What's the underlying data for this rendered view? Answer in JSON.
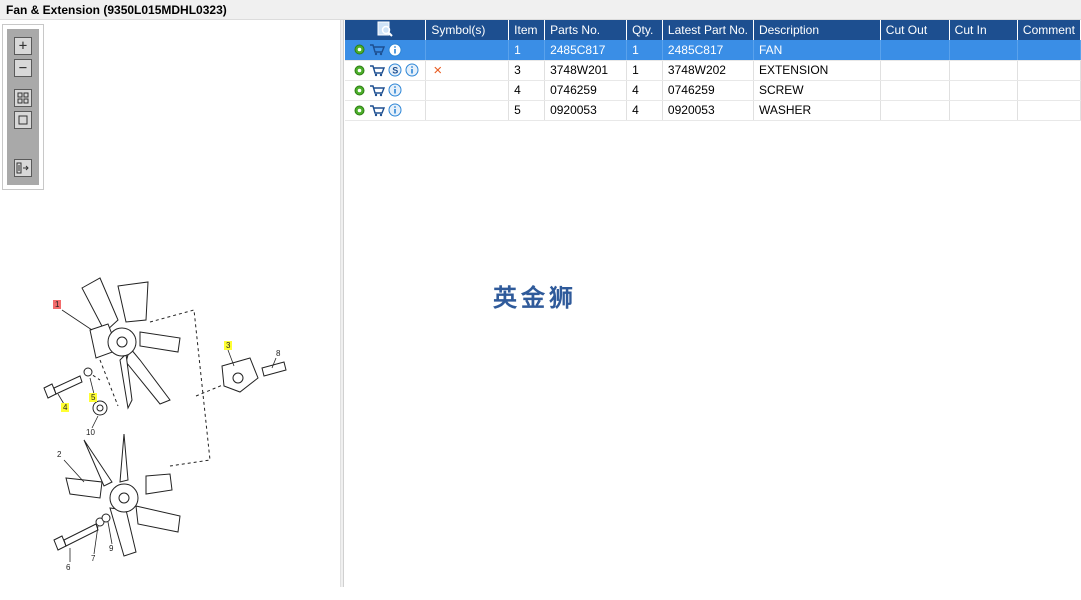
{
  "window": {
    "title": "Fan & Extension (9350L015MDHL0323)"
  },
  "toolbox": {
    "buttons": [
      {
        "name": "zoom-in-icon",
        "glyph": "+"
      },
      {
        "name": "zoom-out-icon",
        "glyph": "−"
      },
      {
        "name": "fit-grid-icon",
        "glyph": "▦"
      },
      {
        "name": "actual-size-icon",
        "glyph": "□"
      },
      {
        "name": "export-list-icon",
        "glyph": "☰"
      }
    ]
  },
  "drawing": {
    "callouts": [
      {
        "label": "1",
        "highlight": "#f26b6b"
      },
      {
        "label": "3",
        "highlight": "#ffff33"
      },
      {
        "label": "4",
        "highlight": "#ffff33"
      },
      {
        "label": "5",
        "highlight": "#ffff33"
      },
      {
        "label": "8",
        "highlight": ""
      },
      {
        "label": "10",
        "highlight": ""
      },
      {
        "label": "2",
        "highlight": ""
      },
      {
        "label": "6",
        "highlight": ""
      },
      {
        "label": "7",
        "highlight": ""
      },
      {
        "label": "9",
        "highlight": ""
      }
    ]
  },
  "table": {
    "header_icon": "search-doc-icon",
    "columns": [
      "",
      "Symbol(s)",
      "Item",
      "Parts No.",
      "Qty.",
      "Latest Part No.",
      "Description",
      "Cut Out",
      "Cut In",
      "Comment"
    ],
    "rows": [
      {
        "icons": [
          "gear-icon",
          "cart-icon",
          "info-icon"
        ],
        "symbol": "",
        "item": "1",
        "part_no": "2485C817",
        "qty": "1",
        "latest": "2485C817",
        "desc": "FAN",
        "cut_out": "",
        "cut_in": "",
        "comment": ""
      },
      {
        "icons": [
          "gear-icon",
          "cart-icon",
          "s-icon",
          "info-icon"
        ],
        "symbol": "×",
        "item": "3",
        "part_no": "3748W201",
        "qty": "1",
        "latest": "3748W202",
        "desc": "EXTENSION",
        "cut_out": "",
        "cut_in": "",
        "comment": ""
      },
      {
        "icons": [
          "gear-icon",
          "cart-icon",
          "info-icon"
        ],
        "symbol": "",
        "item": "4",
        "part_no": "0746259",
        "qty": "4",
        "latest": "0746259",
        "desc": "SCREW",
        "cut_out": "",
        "cut_in": "",
        "comment": ""
      },
      {
        "icons": [
          "gear-icon",
          "cart-icon",
          "info-icon"
        ],
        "symbol": "",
        "item": "5",
        "part_no": "0920053",
        "qty": "4",
        "latest": "0920053",
        "desc": "WASHER",
        "cut_out": "",
        "cut_in": "",
        "comment": ""
      }
    ]
  },
  "watermark": {
    "text": "英金狮"
  },
  "colors": {
    "header": "#1d4f90",
    "selected_row": "#3a8ee6",
    "gear": "#4caf2a",
    "info": "#2e86d6",
    "symbol_x": "#e85a1e"
  }
}
